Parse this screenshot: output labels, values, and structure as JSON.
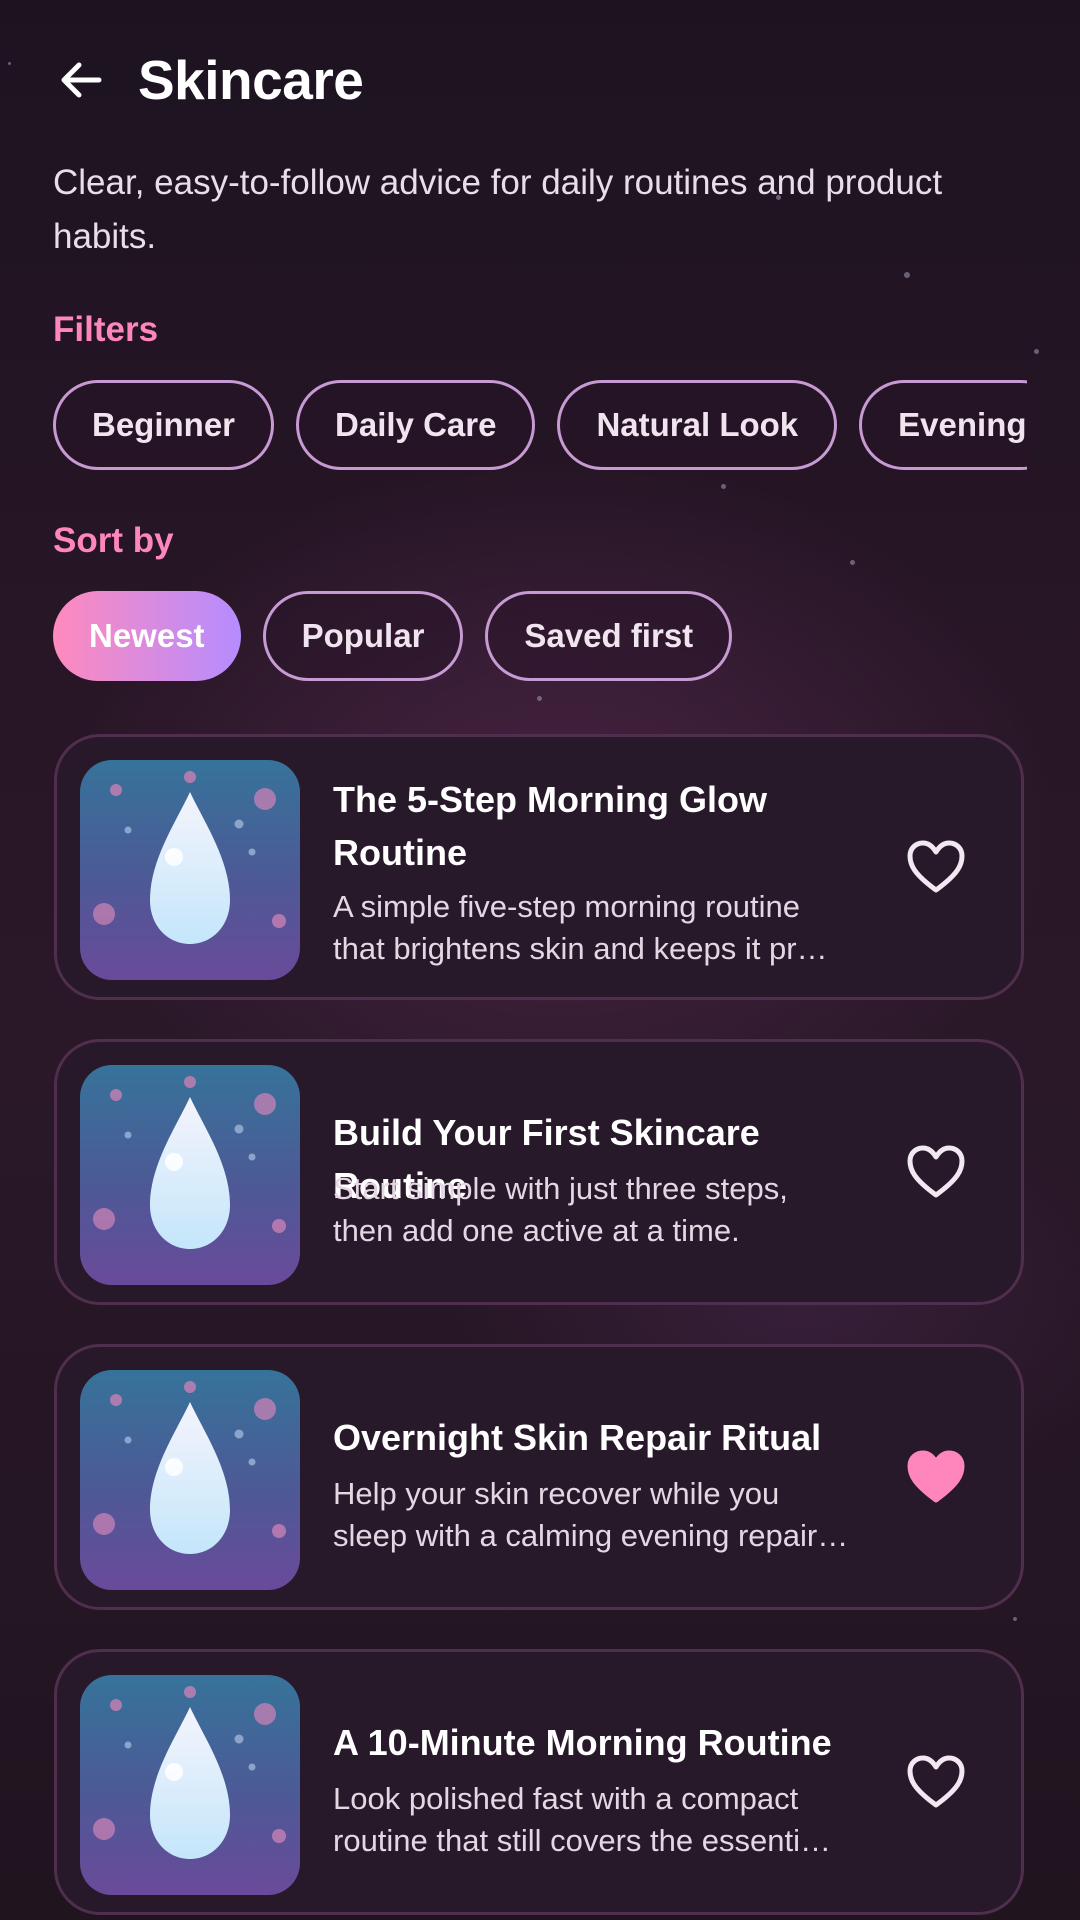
{
  "header": {
    "title": "Skincare"
  },
  "subtitle": "Clear, easy-to-follow advice for daily routines and product habits.",
  "filters": {
    "label": "Filters",
    "chips": [
      "Beginner",
      "Daily Care",
      "Natural Look",
      "Evening"
    ]
  },
  "sort": {
    "label": "Sort by",
    "chips": [
      "Newest",
      "Popular",
      "Saved first"
    ],
    "selected": "Newest"
  },
  "articles": [
    {
      "title_line1": "The 5-Step Morning Glow",
      "title_line2": "Routine",
      "desc_line1": "A simple five-step morning routine",
      "desc_line2": "that brightens skin and keeps it pr…",
      "saved": false
    },
    {
      "title_line1": "Build Your First Skincare Routine",
      "desc_line1": "Start simple with just three steps,",
      "desc_line2": "then add one active at a time.",
      "saved": false
    },
    {
      "title_line1": "Overnight Skin Repair Ritual",
      "desc_line1": "Help your skin recover while you",
      "desc_line2": "sleep with a calming evening repair…",
      "saved": true
    },
    {
      "title_line1": "A 10-Minute Morning Routine",
      "desc_line1": "Look polished fast with a compact",
      "desc_line2": "routine that still covers the essenti…",
      "saved": false
    }
  ],
  "icons": {
    "back": "arrow-left-icon",
    "save": "heart-icon",
    "thumbnail": "water-drop-icon"
  },
  "colors": {
    "accent_pink": "#ff86bd",
    "accent_violet": "#b58cff",
    "chip_border": "#c69ad2",
    "card_background": "#27182a"
  }
}
